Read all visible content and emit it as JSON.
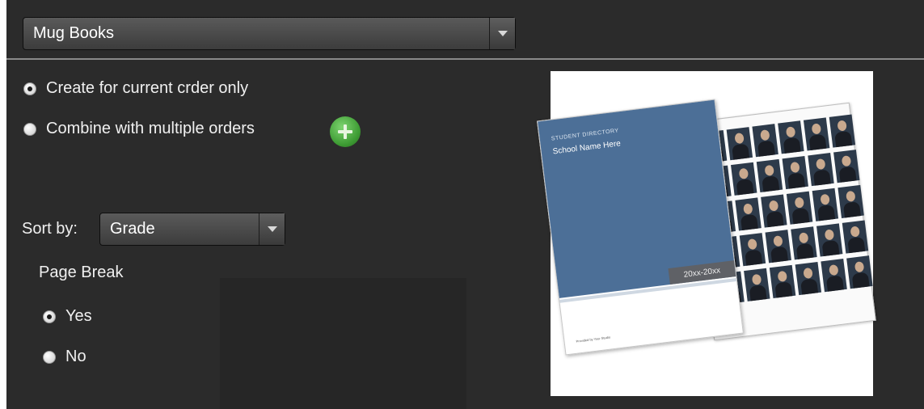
{
  "type_selector": {
    "value": "Mug Books"
  },
  "scope_options": [
    {
      "label": "Create for current crder only",
      "selected": true
    },
    {
      "label": "Combine with multiple orders",
      "selected": false
    }
  ],
  "sort": {
    "label": "Sort by:",
    "value": "Grade"
  },
  "page_break": {
    "label": "Page Break",
    "options": [
      {
        "label": "Yes",
        "selected": true
      },
      {
        "label": "No",
        "selected": false
      }
    ]
  },
  "preview": {
    "cover_eyebrow": "STUDENT DIRECTORY",
    "cover_title": "School Name Here",
    "year_range": "20xx-20xx",
    "footer": "Provided by Your Studio"
  },
  "colors": {
    "background": "#2b2b2b",
    "add_button": "#3c9a32",
    "cover": "#4c6f97"
  },
  "icons": {
    "add": "plus-icon",
    "dropdown": "chevron-down-icon"
  }
}
